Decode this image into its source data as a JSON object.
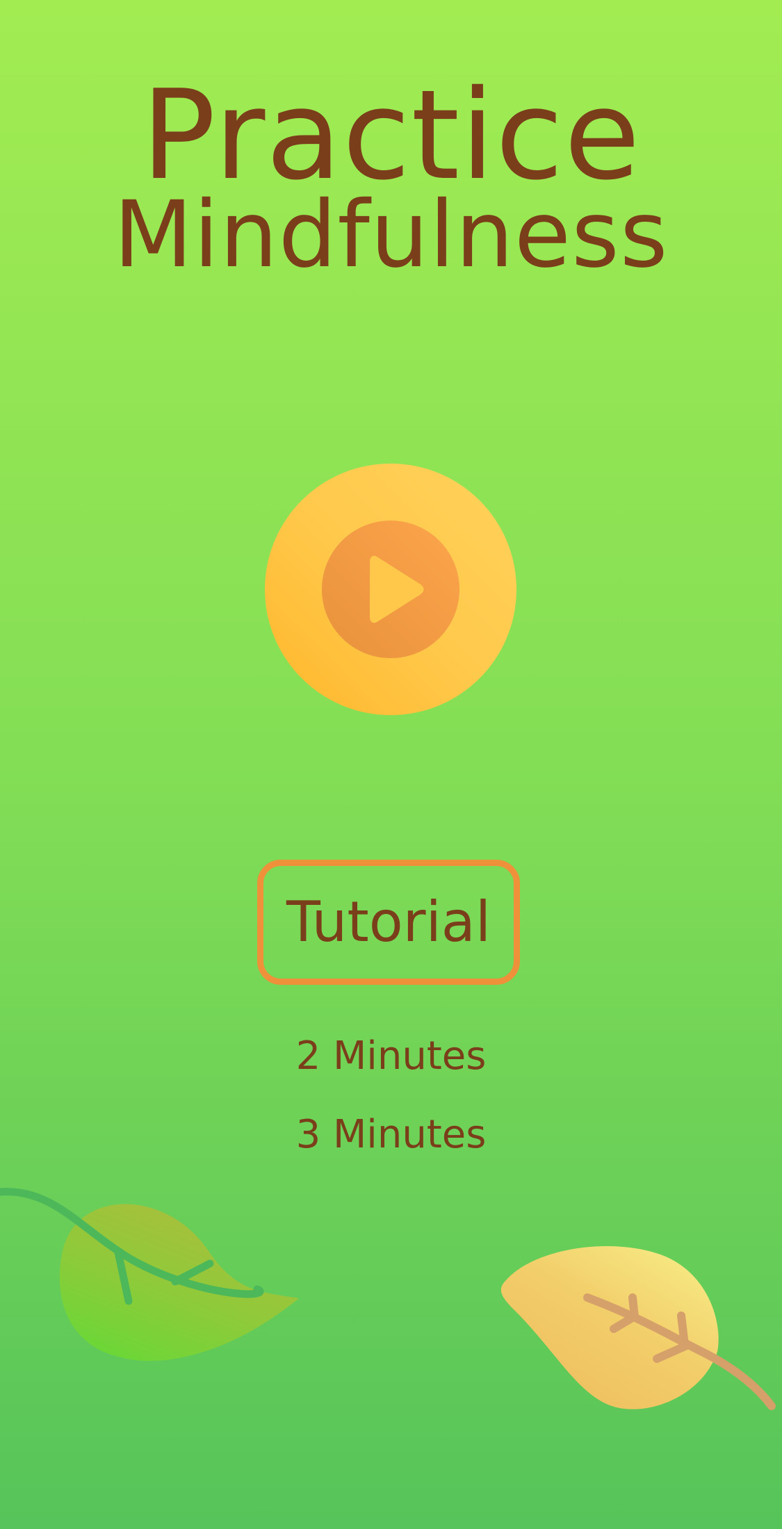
{
  "title": {
    "line1": "Practice",
    "line2": "Mindfulness"
  },
  "play": {
    "icon": "play-icon"
  },
  "tutorial": {
    "label": "Tutorial"
  },
  "durations": [
    {
      "label": "2 Minutes"
    },
    {
      "label": "3 Minutes"
    }
  ],
  "decorations": {
    "left_leaf": "green-leaf-icon",
    "right_leaf": "yellow-leaf-icon"
  },
  "colors": {
    "background_top": "#A2EC52",
    "background_bottom": "#56C45A",
    "text_brown": "#7A3E1A",
    "accent_orange": "#EE913A",
    "play_outer": "#FFC94C",
    "play_inner": "#F29B44"
  }
}
